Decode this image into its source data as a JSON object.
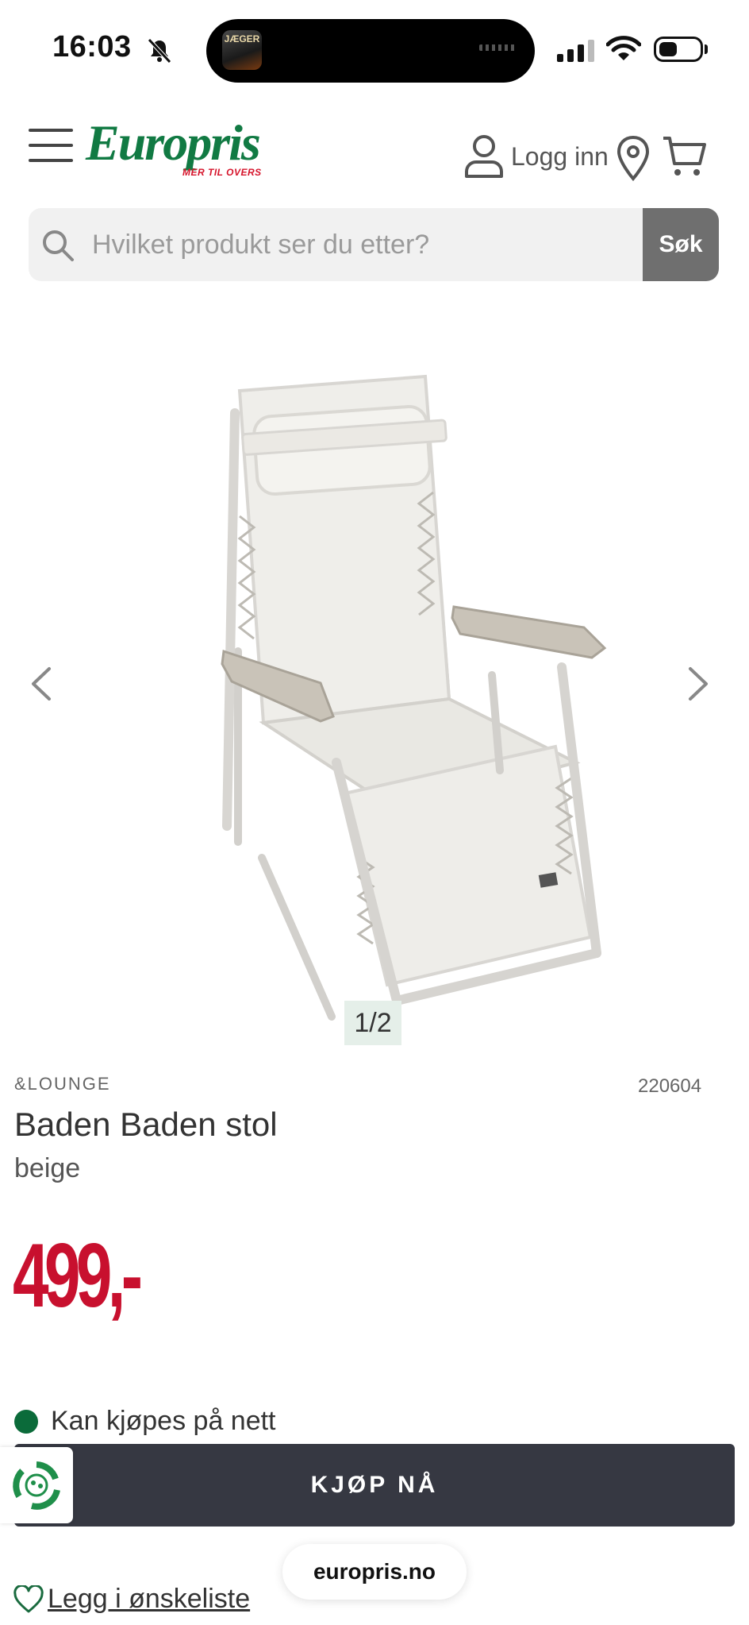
{
  "status_bar": {
    "time": "16:03",
    "island_app_label": "JÆGER"
  },
  "header": {
    "logo_text": "Europris",
    "logo_tagline": "MER TIL OVERS",
    "login_label": "Logg inn"
  },
  "search": {
    "placeholder": "Hvilket produkt ser du etter?",
    "button_label": "Søk"
  },
  "gallery": {
    "counter": "1/2",
    "image_subject": "reclining lounge chair beige"
  },
  "product": {
    "brand": "&LOUNGE",
    "sku": "220604",
    "title": "Baden Baden stol",
    "variant": "beige",
    "price": "499,-",
    "availability": "Kan kjøpes på nett",
    "buy_label": "KJØP NÅ",
    "wishlist_label": "Legg i ønskeliste"
  },
  "browser": {
    "url": "europris.no"
  },
  "colors": {
    "brand_green": "#117a43",
    "price_red": "#c8102e",
    "buy_button": "#363842",
    "availability_dot": "#0b6b3a"
  },
  "icons": [
    "bell-slash-icon",
    "menu-icon",
    "user-icon",
    "location-pin-icon",
    "cart-icon",
    "search-icon",
    "chevron-left-icon",
    "chevron-right-icon",
    "recycle-icon",
    "heart-icon"
  ]
}
